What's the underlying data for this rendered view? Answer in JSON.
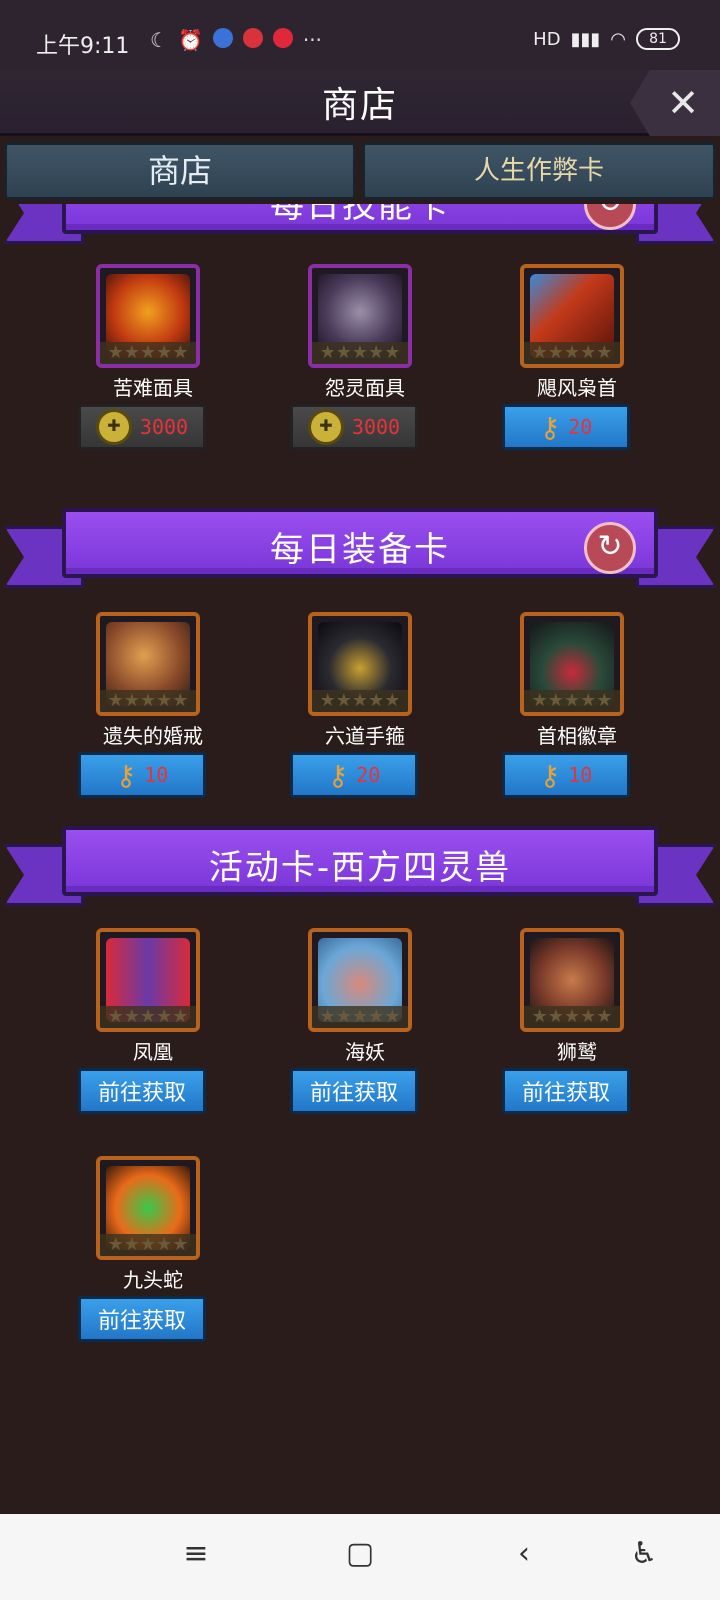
{
  "status": {
    "time": "上午9:11",
    "network": "HD",
    "battery": "81"
  },
  "header": {
    "title": "商店",
    "close": "✕"
  },
  "tabs": [
    {
      "label": "商店"
    },
    {
      "label": "人生作弊卡"
    }
  ],
  "sections": [
    {
      "title": "每日技能卡",
      "items": [
        {
          "name": "苦难面具",
          "price": "3000",
          "currency": "coin-icon",
          "frame": "#8b2ea6"
        },
        {
          "name": "怨灵面具",
          "price": "3000",
          "currency": "coin-icon",
          "frame": "#8b2ea6"
        },
        {
          "name": "飓风枭首",
          "price": "20",
          "currency": "key-icon",
          "frame": "#b8621e"
        }
      ]
    },
    {
      "title": "每日装备卡",
      "items": [
        {
          "name": "遗失的婚戒",
          "price": "10",
          "currency": "key-icon"
        },
        {
          "name": "六道手箍",
          "price": "20",
          "currency": "key-icon"
        },
        {
          "name": "首相徽章",
          "price": "10",
          "currency": "key-icon"
        }
      ]
    },
    {
      "title": "活动卡-西方四灵兽",
      "items": [
        {
          "name": "凤凰",
          "action": "前往获取"
        },
        {
          "name": "海妖",
          "action": "前往获取"
        },
        {
          "name": "狮鹫",
          "action": "前往获取"
        },
        {
          "name": "九头蛇",
          "action": "前往获取"
        }
      ]
    }
  ],
  "navbar": {
    "menu": "≡",
    "home": "▢",
    "back": "‹",
    "accessibility": "♿"
  }
}
